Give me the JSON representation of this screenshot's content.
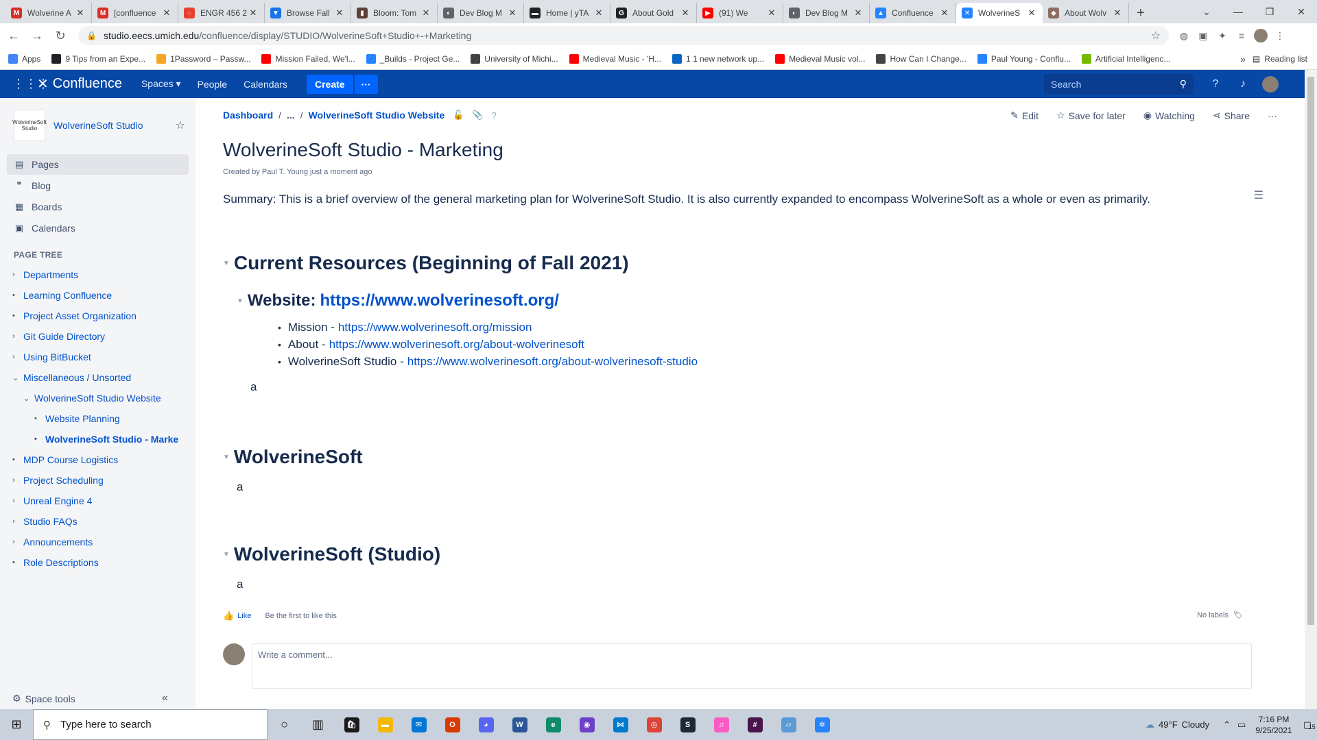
{
  "browser": {
    "tabs": [
      {
        "label": "Wolverine A",
        "color": "#d93025",
        "glyph": "M"
      },
      {
        "label": "[confluence",
        "color": "#d93025",
        "glyph": "M"
      },
      {
        "label": "ENGR 456 2",
        "color": "#e84030",
        "glyph": "◌"
      },
      {
        "label": "Browse Fall",
        "color": "#1a73e8",
        "glyph": "▼"
      },
      {
        "label": "Bloom: Tom",
        "color": "#5d4037",
        "glyph": "▮"
      },
      {
        "label": "Dev Blog M",
        "color": "#5f6368",
        "glyph": "◐"
      },
      {
        "label": "Home | yTA",
        "color": "#202124",
        "glyph": "▬"
      },
      {
        "label": "About Gold",
        "color": "#202124",
        "glyph": "G"
      },
      {
        "label": "(91) We",
        "color": "#ff0000",
        "glyph": "▶"
      },
      {
        "label": "Dev Blog M",
        "color": "#5f6368",
        "glyph": "◐"
      },
      {
        "label": "Confluence",
        "color": "#2684ff",
        "glyph": "▲"
      },
      {
        "label": "WolverineS",
        "color": "#2684ff",
        "glyph": "✕",
        "active": true
      },
      {
        "label": "About Wolv",
        "color": "#8d6e63",
        "glyph": "◆"
      }
    ],
    "new_tab": "+",
    "url_host": "studio.eecs.umich.edu",
    "url_path": "/confluence/display/STUDIO/WolverineSoft+Studio+-+Marketing",
    "bookmarks": [
      {
        "label": "Apps",
        "color": "#4285f4"
      },
      {
        "label": "9 Tips from an Expe...",
        "color": "#202124"
      },
      {
        "label": "1Password – Passw...",
        "color": "#f5a623"
      },
      {
        "label": "Mission Failed, We'l...",
        "color": "#ff0000"
      },
      {
        "label": "_Builds - Project Ge...",
        "color": "#2684ff"
      },
      {
        "label": "University of Michi...",
        "color": "#424242"
      },
      {
        "label": "Medieval Music - 'H...",
        "color": "#ff0000"
      },
      {
        "label": "1 1 new network up...",
        "color": "#0a66c2"
      },
      {
        "label": "Medieval Music vol...",
        "color": "#ff0000"
      },
      {
        "label": "How Can I Change...",
        "color": "#444"
      },
      {
        "label": "Paul Young - Conflu...",
        "color": "#2684ff"
      },
      {
        "label": "Artificial Intelligenc...",
        "color": "#76b900"
      }
    ],
    "reading_list": "Reading list"
  },
  "header": {
    "product": "Confluence",
    "spaces": "Spaces ▾",
    "people": "People",
    "calendars": "Calendars",
    "create": "Create",
    "more": "···",
    "search_placeholder": "Search"
  },
  "sidebar": {
    "space_name": "WolverineSoft Studio",
    "logo_text": "WolverineSoft Studio",
    "nav": [
      {
        "label": "Pages",
        "icon": "▤"
      },
      {
        "label": "Blog",
        "icon": "❞"
      },
      {
        "label": "Boards",
        "icon": "▦"
      },
      {
        "label": "Calendars",
        "icon": "▣"
      }
    ],
    "page_tree_title": "PAGE TREE",
    "tree": [
      {
        "label": "Departments",
        "marker": "›",
        "indent": 0
      },
      {
        "label": "Learning Confluence",
        "marker": "•",
        "indent": 0
      },
      {
        "label": "Project Asset Organization",
        "marker": "•",
        "indent": 0
      },
      {
        "label": "Git Guide Directory",
        "marker": "›",
        "indent": 0
      },
      {
        "label": "Using BitBucket",
        "marker": "›",
        "indent": 0
      },
      {
        "label": "Miscellaneous / Unsorted",
        "marker": "⌄",
        "indent": 0
      },
      {
        "label": "WolverineSoft Studio Website",
        "marker": "⌄",
        "indent": 1
      },
      {
        "label": "Website Planning",
        "marker": "•",
        "indent": 2
      },
      {
        "label": "WolverineSoft Studio - Marke",
        "marker": "•",
        "indent": 2,
        "current": true
      },
      {
        "label": "MDP Course Logistics",
        "marker": "•",
        "indent": 0
      },
      {
        "label": "Project Scheduling",
        "marker": "›",
        "indent": 0
      },
      {
        "label": "Unreal Engine 4",
        "marker": "›",
        "indent": 0
      },
      {
        "label": "Studio FAQs",
        "marker": "›",
        "indent": 0
      },
      {
        "label": "Announcements",
        "marker": "›",
        "indent": 0
      },
      {
        "label": "Role Descriptions",
        "marker": "•",
        "indent": 0
      }
    ],
    "space_tools": "Space tools"
  },
  "page": {
    "breadcrumb": [
      "Dashboard",
      "...",
      "WolverineSoft Studio Website"
    ],
    "actions": {
      "edit": "Edit",
      "save": "Save for later",
      "watching": "Watching",
      "share": "Share",
      "more": "···"
    },
    "title": "WolverineSoft Studio - Marketing",
    "byline": "Created by Paul T. Young just a moment ago",
    "summary": "Summary: This is a brief overview of the general marketing plan for WolverineSoft Studio. It is also currently expanded to encompass WolverineSoft as a whole or even as primarily.",
    "section1": {
      "heading": "Current Resources (Beginning of Fall 2021)",
      "sub_label": "Website:",
      "sub_link": "https://www.wolverinesoft.org/",
      "items": [
        {
          "label": "Mission -",
          "link": "https://www.wolverinesoft.org/mission"
        },
        {
          "label": "About -",
          "link": "https://www.wolverinesoft.org/about-wolverinesoft"
        },
        {
          "label": "WolverineSoft Studio -",
          "link": "https://www.wolverinesoft.org/about-wolverinesoft-studio"
        }
      ],
      "body": "a"
    },
    "section2": {
      "heading": "WolverineSoft",
      "body": "a"
    },
    "section3": {
      "heading": "WolverineSoft (Studio)",
      "body": "a"
    },
    "like": "Like",
    "like_note": "Be the first to like this",
    "labels": "No labels",
    "comment_placeholder": "Write a comment..."
  },
  "taskbar": {
    "search_placeholder": "Type here to search",
    "temperature": "49°F",
    "weather": "Cloudy",
    "time": "7:16 PM",
    "date": "9/25/2021",
    "notifications": "15",
    "apps": [
      {
        "name": "cortana",
        "color": "#1b1b1b",
        "glyph": "○"
      },
      {
        "name": "task-view",
        "color": "#1b1b1b",
        "glyph": "▥"
      },
      {
        "name": "store",
        "color": "#1b1b1b",
        "glyph": "🛍"
      },
      {
        "name": "file-explorer",
        "color": "#f2b900",
        "glyph": "▬"
      },
      {
        "name": "mail",
        "color": "#0078d4",
        "glyph": "✉"
      },
      {
        "name": "office",
        "color": "#d83b01",
        "glyph": "O"
      },
      {
        "name": "discord",
        "color": "#5865f2",
        "glyph": "◕"
      },
      {
        "name": "word",
        "color": "#2b579a",
        "glyph": "W"
      },
      {
        "name": "edge",
        "color": "#0f8a6a",
        "glyph": "e"
      },
      {
        "name": "github",
        "color": "#6e40c9",
        "glyph": "◉"
      },
      {
        "name": "vscode",
        "color": "#007acc",
        "glyph": "⋈"
      },
      {
        "name": "chrome",
        "color": "#db4437",
        "glyph": "◎"
      },
      {
        "name": "steam",
        "color": "#1b2838",
        "glyph": "S"
      },
      {
        "name": "itunes",
        "color": "#fb5bc5",
        "glyph": "♫"
      },
      {
        "name": "slack",
        "color": "#4a154b",
        "glyph": "#"
      },
      {
        "name": "notepad",
        "color": "#5a9bd5",
        "glyph": "▱"
      },
      {
        "name": "jira",
        "color": "#2684ff",
        "glyph": "✲"
      }
    ]
  }
}
